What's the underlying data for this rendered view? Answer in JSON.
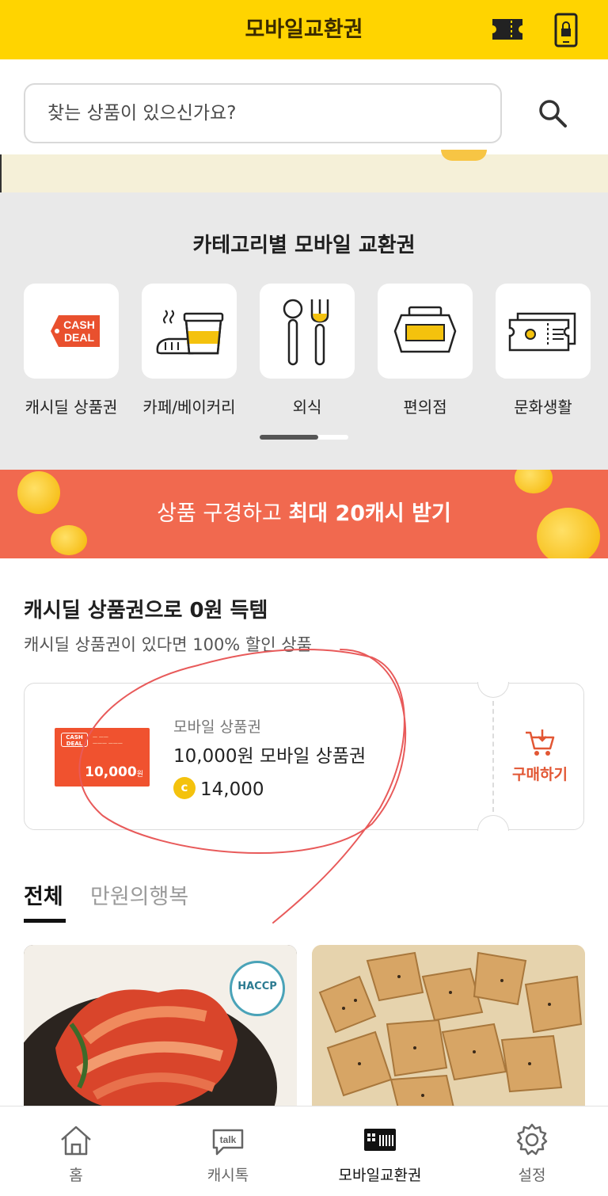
{
  "header": {
    "title": "모바일교환권"
  },
  "search": {
    "placeholder": "찾는 상품이 있으신가요?"
  },
  "categories": {
    "title": "카테고리별 모바일 교환권",
    "items": [
      {
        "label": "캐시딜 상품권",
        "icon": "cash-deal-icon"
      },
      {
        "label": "카페/베이커리",
        "icon": "cafe-bakery-icon"
      },
      {
        "label": "외식",
        "icon": "dining-icon"
      },
      {
        "label": "편의점",
        "icon": "convenience-store-icon"
      },
      {
        "label": "문화생활",
        "icon": "culture-ticket-icon"
      }
    ],
    "cash_deal_logo": [
      "CASH",
      "DEAL"
    ]
  },
  "promo": {
    "text_plain": "상품 구경하고 ",
    "text_bold": "최대 20캐시 받기"
  },
  "deal": {
    "title": "캐시딜 상품권으로 0원 득템",
    "subtitle": "캐시딜 상품권이 있다면 100% 할인 상품",
    "card": {
      "category": "모바일 상품권",
      "name": "10,000원 모바일 상품권",
      "price": "14,000",
      "coin_letter": "c",
      "voucher_logo": [
        "CASH",
        "DEAL"
      ],
      "voucher_amount": "10,000",
      "voucher_unit": "원",
      "buy_label": "구매하기"
    }
  },
  "tabs": [
    {
      "label": "전체",
      "active": true
    },
    {
      "label": "만원의행복",
      "active": false
    }
  ],
  "products": [
    {
      "badge": "HACCP"
    },
    {
      "badge": ""
    }
  ],
  "bottom_nav": [
    {
      "label": "홈",
      "icon": "home-icon",
      "active": false
    },
    {
      "label": "캐시톡",
      "icon": "talk-icon",
      "active": false
    },
    {
      "label": "모바일교환권",
      "icon": "gift-ticket-icon",
      "active": true
    },
    {
      "label": "설정",
      "icon": "gear-icon",
      "active": false
    }
  ],
  "colors": {
    "header": "#FFD400",
    "promo": "#F1694F",
    "accent": "#E25734",
    "category_bg": "#E9E9E9"
  }
}
